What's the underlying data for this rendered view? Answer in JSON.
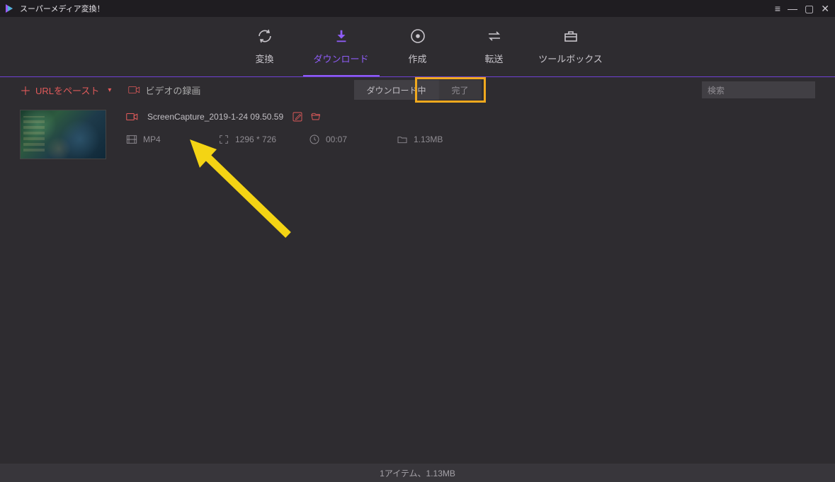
{
  "titlebar": {
    "app_name": "スーパーメディア変換！"
  },
  "topnav": {
    "tabs": [
      {
        "label": "変換"
      },
      {
        "label": "ダウンロード"
      },
      {
        "label": "作成"
      },
      {
        "label": "転送"
      },
      {
        "label": "ツールボックス"
      }
    ],
    "active_index": 1
  },
  "toolbar": {
    "paste_label": "URLをペースト",
    "record_label": "ビデオの録画",
    "seg_downloading": "ダウンロード中",
    "seg_complete": "完了",
    "search_placeholder": "検索"
  },
  "file": {
    "name": "ScreenCapture_2019-1-24 09.50.59",
    "format": "MP4",
    "resolution": "1296 * 726",
    "duration": "00:07",
    "size": "1.13MB"
  },
  "status": {
    "text": "1アイテム、1.13MB"
  }
}
